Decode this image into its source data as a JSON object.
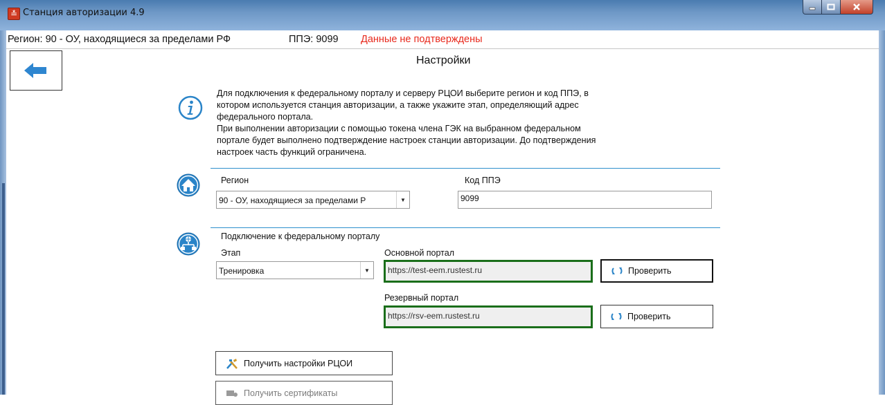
{
  "window": {
    "title": "Станция авторизации 4.9",
    "app_icon": "app-logo-icon",
    "buttons": [
      "minimize-icon",
      "maximize-icon",
      "close-icon"
    ]
  },
  "status": {
    "region": "Регион: 90 - ОУ, находящиеся за пределами РФ",
    "ppe": "ППЭ: 9099",
    "warning": "Данные не подтверждены",
    "warning_color": "#e8291c"
  },
  "page": {
    "title": "Настройки",
    "back_icon": "arrow-left-icon"
  },
  "info": {
    "icon": "info-icon",
    "lines": [
      "Для подключения к федеральному порталу и серверу РЦОИ выберите регион и код ППЭ, в",
      "котором используется станция авторизации, а также укажите этап, определяющий адрес",
      "федерального портала.",
      "При выполнении авторизации с помощью токена члена ГЭК на выбранном федеральном",
      "портале будет выполнено подтверждение настроек станции авторизации. До подтверждения",
      "настроек часть функций ограничена."
    ]
  },
  "region_section": {
    "icon": "home-icon",
    "region_label": "Регион",
    "region_value": "90 - ОУ, находящиеся за пределами Р",
    "ppe_label": "Код ППЭ",
    "ppe_value": "9099"
  },
  "portal_section": {
    "icon": "network-icon",
    "title": "Подключение к федеральному порталу",
    "stage_label": "Этап",
    "stage_value": "Тренировка",
    "main_label": "Основной портал",
    "main_value": "https://test-eem.rustest.ru",
    "reserve_label": "Резервный портал",
    "reserve_value": "https://rsv-eem.rustest.ru",
    "check_label": "Проверить",
    "check_icon": "refresh-icon",
    "accent_color": "#1a6e1a"
  },
  "actions": {
    "get_settings": "Получить настройки РЦОИ",
    "get_settings_icon": "tools-icon",
    "get_certs": "Получить сертификаты",
    "get_certs_icon": "certificate-icon"
  }
}
